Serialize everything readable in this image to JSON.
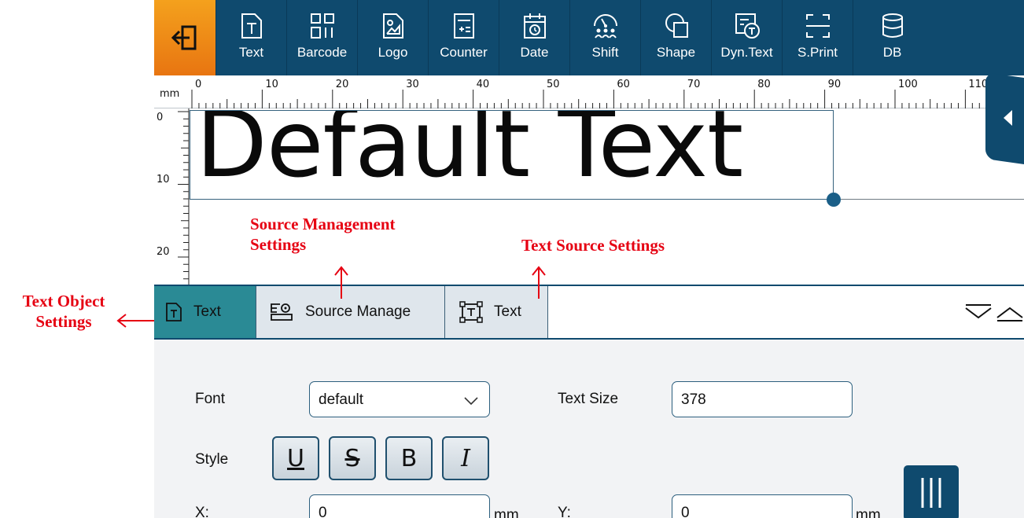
{
  "toolbar": {
    "items": [
      {
        "label": "Text",
        "icon": "text-icon"
      },
      {
        "label": "Barcode",
        "icon": "barcode-icon"
      },
      {
        "label": "Logo",
        "icon": "logo-icon"
      },
      {
        "label": "Counter",
        "icon": "counter-icon"
      },
      {
        "label": "Date",
        "icon": "date-icon"
      },
      {
        "label": "Shift",
        "icon": "shift-icon"
      },
      {
        "label": "Shape",
        "icon": "shape-icon"
      },
      {
        "label": "Dyn.Text",
        "icon": "dyn-text-icon"
      },
      {
        "label": "S.Print",
        "icon": "s-print-icon"
      },
      {
        "label": "DB",
        "icon": "db-icon"
      }
    ],
    "exit_icon": "exit-icon"
  },
  "ruler": {
    "unit": "mm",
    "h_labels": [
      "0",
      "10",
      "20",
      "30",
      "40",
      "50",
      "60",
      "70",
      "80",
      "90",
      "100",
      "110"
    ],
    "v_labels": [
      "0",
      "10",
      "20"
    ]
  },
  "canvas": {
    "text_object": "Default Text"
  },
  "tabs": [
    {
      "label": "Text",
      "icon": "text-object-icon",
      "active": true
    },
    {
      "label": "Source Manage",
      "icon": "source-manage-icon",
      "active": false
    },
    {
      "label": "Text",
      "icon": "text-source-icon",
      "active": false
    }
  ],
  "panel": {
    "font_label": "Font",
    "font_value": "default",
    "text_size_label": "Text Size",
    "text_size_value": "378",
    "style_label": "Style",
    "style_buttons": [
      "U",
      "S",
      "B",
      "I"
    ],
    "x_label": "X:",
    "x_value": "0",
    "x_unit": "mm",
    "y_label": "Y:",
    "y_value": "0",
    "y_unit": "mm"
  },
  "annotations": {
    "text_object": "Text Object Settings",
    "source_management": "Source Management Settings",
    "text_source": "Text Source Settings"
  },
  "colors": {
    "toolbar_bg": "#0f4a6e",
    "exit_orange": "#f08a17",
    "active_tab": "#2a8a95",
    "annotation_red": "#e60012"
  }
}
